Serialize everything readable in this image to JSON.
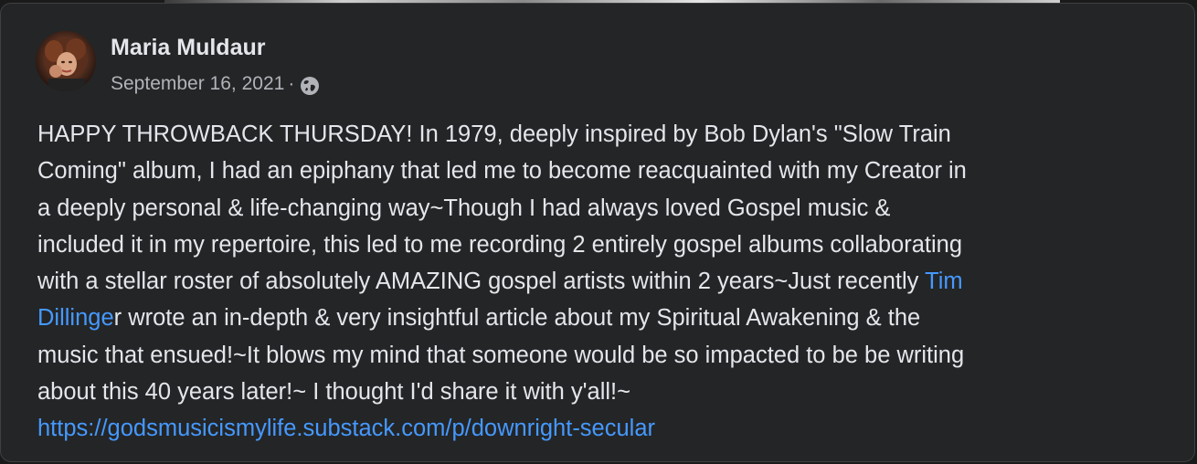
{
  "post": {
    "author": "Maria Muldaur",
    "date": "September 16, 2021",
    "separator": "·",
    "privacy_icon": "globe-icon",
    "body_lines": [
      [
        "HAPPY THROWBACK THURSDAY! In 1979, deeply inspired by Bob Dylan's \"Slow Train"
      ],
      [
        "Coming\" album, I had an epiphany that led me to become reacquainted with my Creator in"
      ],
      [
        "a deeply personal & life-changing way~Though I had always loved Gospel music &"
      ],
      [
        "included it in my repertoire, this led to me recording 2 entirely gospel albums collaborating"
      ],
      [
        "with a stellar roster of absolutely AMAZING gospel artists within 2 years~Just recently "
      ],
      [
        "r wrote an in-depth & very insightful article about my Spiritual Awakening & the"
      ],
      [
        "music that ensued!~It blows my mind that someone would be so impacted to be be writing"
      ],
      [
        "about this 40 years later!~ I thought I'd share it with y'all!~"
      ]
    ],
    "mention_part1": "Tim",
    "mention_part2": "Dillinge",
    "url": "https://godsmusicismylife.substack.com/p/downright-secular"
  },
  "colors": {
    "background": "#242526",
    "text": "#e4e6eb",
    "secondary_text": "#b0b3b8",
    "link": "#4599ff"
  }
}
